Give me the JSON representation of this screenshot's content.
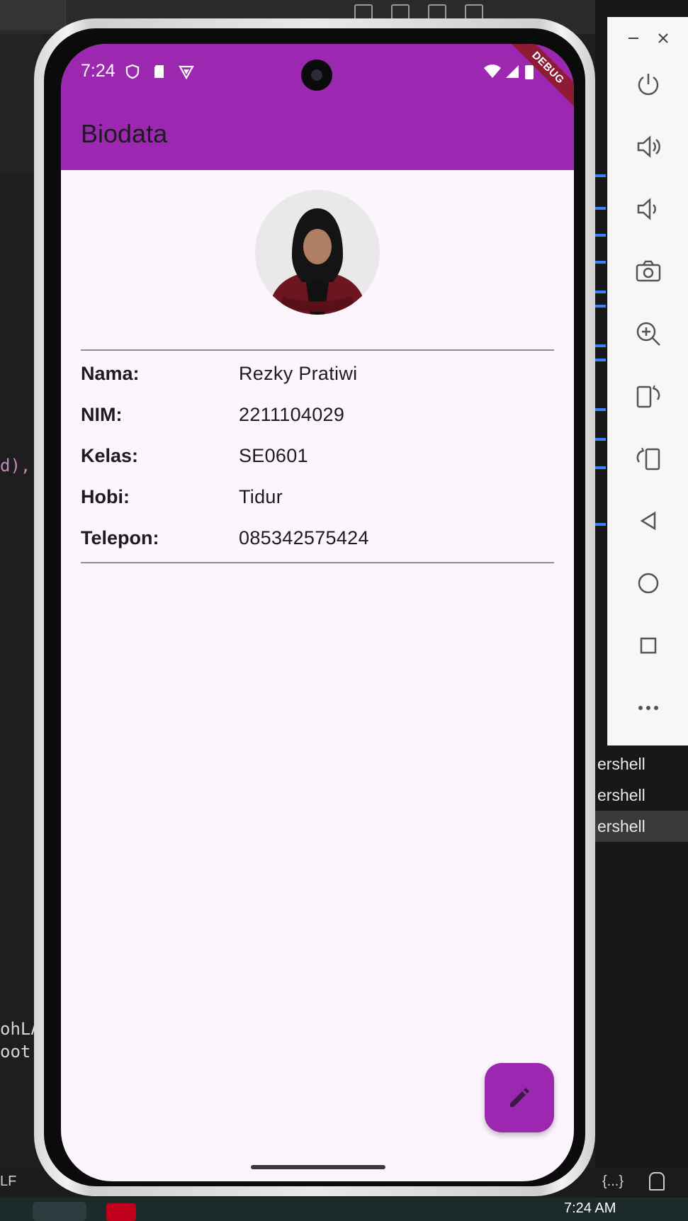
{
  "ide": {
    "code_fragments": [
      "d),",
      "ohLA",
      "oot"
    ],
    "terminal_rows": [
      "ershell",
      "ershell",
      "ershell"
    ],
    "statusbar_left": "LF",
    "statusbar_right": "{...}",
    "clock": "7:24 AM"
  },
  "emulator": {
    "buttons": [
      "power-icon",
      "volume-up-icon",
      "volume-down-icon",
      "camera-icon",
      "zoom-in-icon",
      "rotate-right-icon",
      "rotate-left-icon",
      "back-icon",
      "home-icon",
      "overview-icon",
      "more-icon"
    ]
  },
  "status_bar": {
    "time": "7:24",
    "debug_banner": "DEBUG"
  },
  "app": {
    "title": "Biodata",
    "colors": {
      "primary": "#9c27b0",
      "background": "#fdf5fd"
    },
    "profile": [
      {
        "label": "Nama:",
        "value": "Rezky Pratiwi"
      },
      {
        "label": "NIM:",
        "value": "2211104029"
      },
      {
        "label": "Kelas:",
        "value": "SE0601"
      },
      {
        "label": "Hobi:",
        "value": "Tidur"
      },
      {
        "label": "Telepon:",
        "value": "085342575424"
      }
    ],
    "fab_icon": "edit-icon"
  }
}
